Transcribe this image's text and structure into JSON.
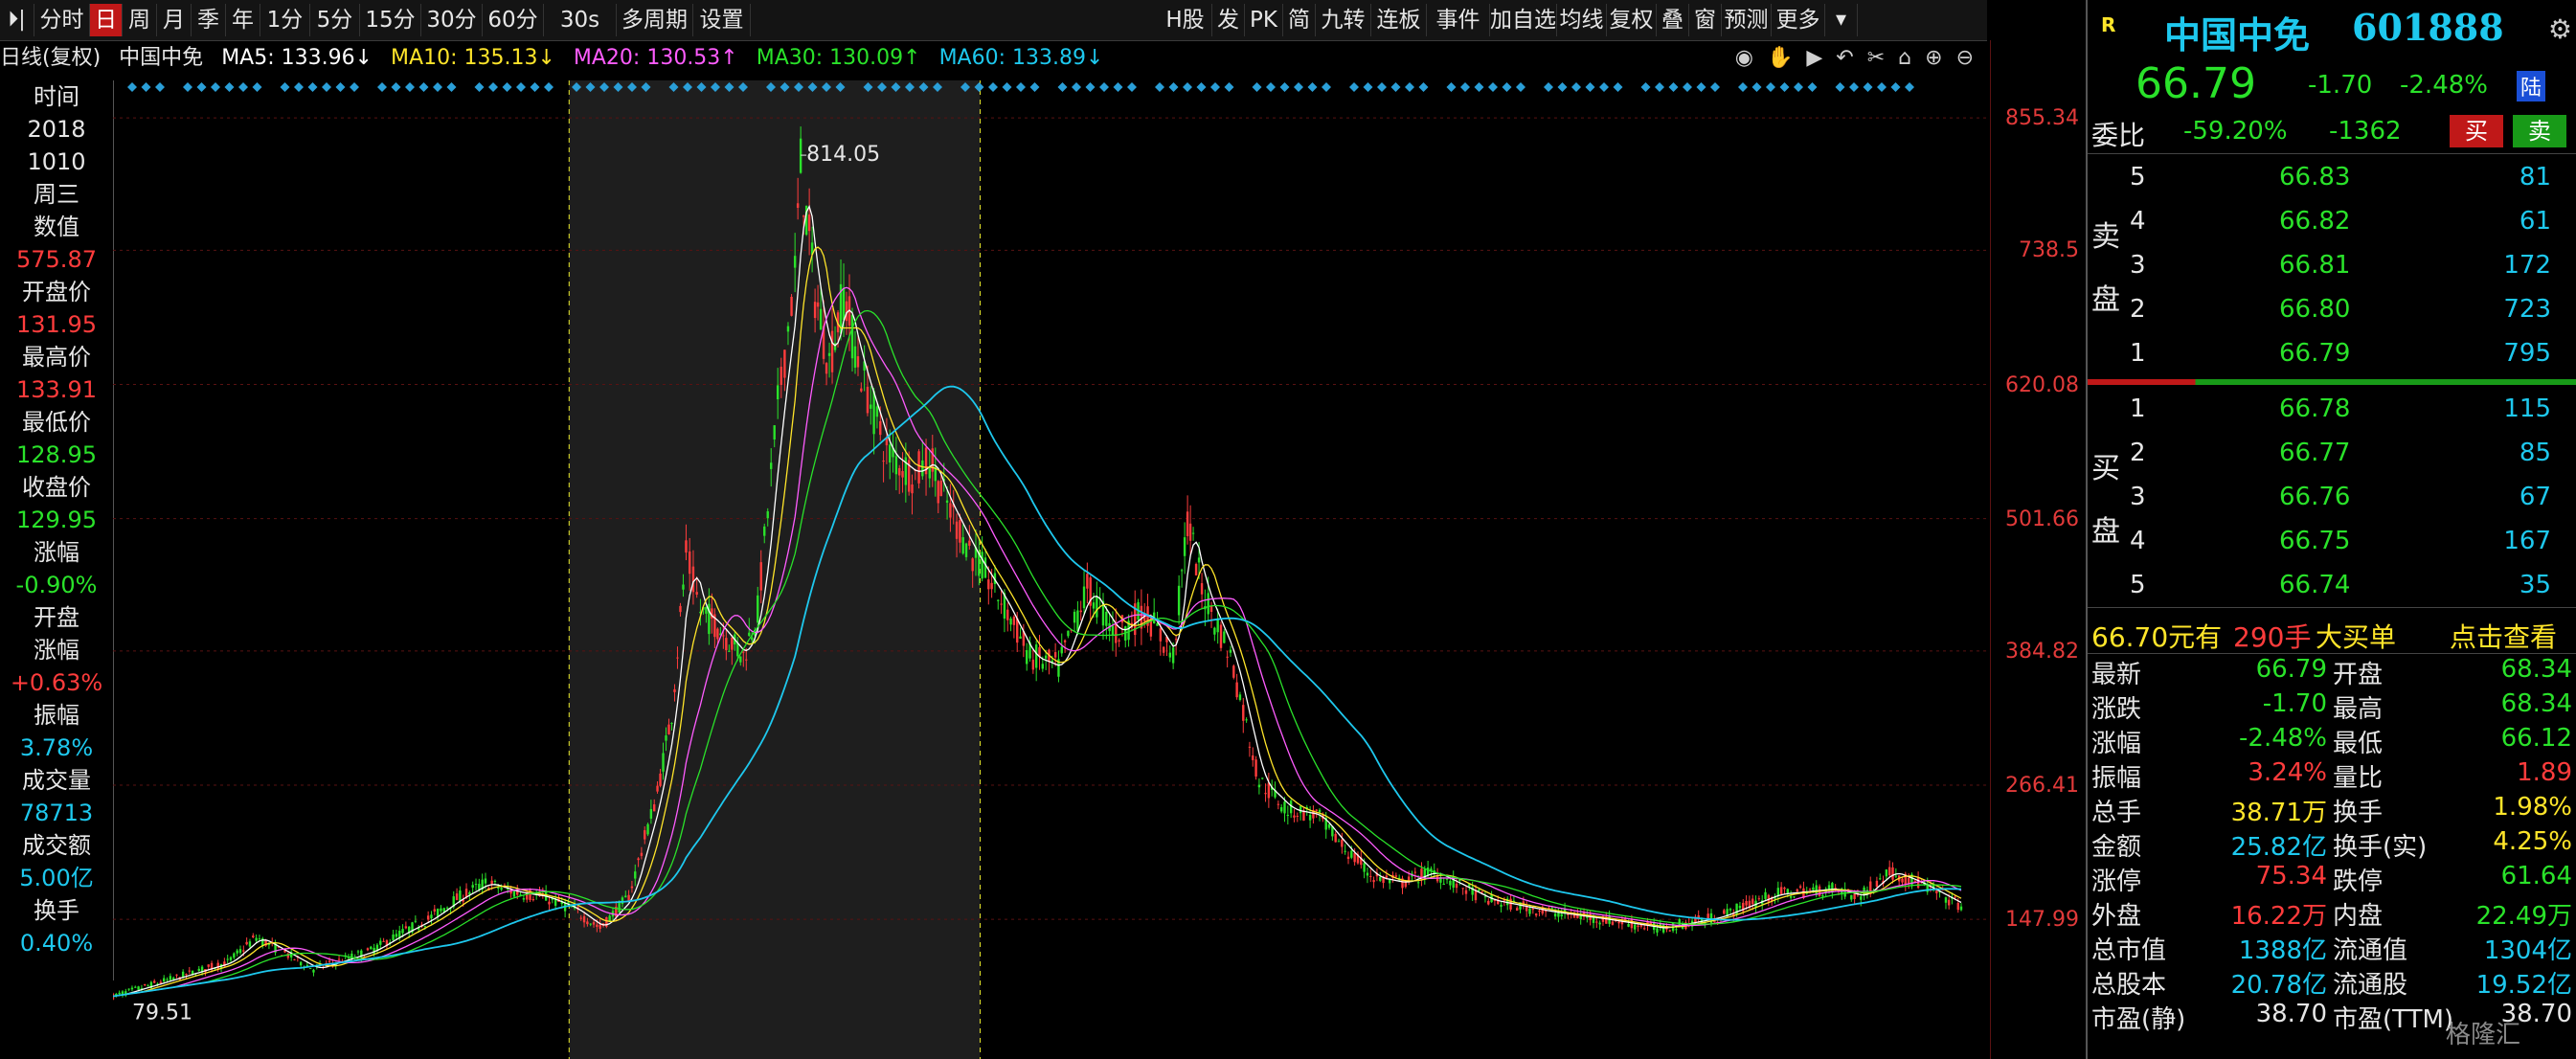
{
  "toolbar": {
    "items": [
      "分时",
      "日",
      "周",
      "月",
      "季",
      "年",
      "1分",
      "5分",
      "15分",
      "30分",
      "60分",
      "30s",
      "多周期",
      "设置"
    ],
    "active": "日",
    "right_items": [
      "H股",
      "发",
      "PK",
      "简",
      "九转",
      "连板",
      "事件",
      "加自选",
      "均线",
      "复权",
      "叠",
      "窗",
      "预测",
      "更多"
    ]
  },
  "ma": {
    "title": "日线(复权)",
    "stock": "中国中免",
    "ma5": "MA5: 133.96↓",
    "ma10": "MA10: 135.13↓",
    "ma20": "MA20: 130.53↑",
    "ma30": "MA30: 130.09↑",
    "ma60": "MA60: 133.89↓",
    "colors": {
      "ma5": "#ffffff",
      "ma10": "#ffe52a",
      "ma20": "#ff5cff",
      "ma30": "#2ae22a",
      "ma60": "#1ec8ee"
    }
  },
  "info": {
    "time_label": "时间",
    "year": "2018",
    "date": "1010",
    "weekday": "周三",
    "value_label": "数值",
    "value": "575.87",
    "open_label": "开盘价",
    "open": "131.95",
    "high_label": "最高价",
    "high": "133.91",
    "low_label": "最低价",
    "low": "128.95",
    "close_label": "收盘价",
    "close": "129.95",
    "chg_label": "涨幅",
    "chg": "-0.90%",
    "open_chg_label1": "开盘",
    "open_chg_label2": "涨幅",
    "open_chg": "+0.63%",
    "amp_label": "振幅",
    "amp": "3.78%",
    "vol_label": "成交量",
    "vol": "78713",
    "amt_label": "成交额",
    "amt": "5.00亿",
    "turn_label": "换手",
    "turn": "0.40%"
  },
  "chart_data": {
    "type": "line",
    "title": "中国中免 日线(复权)",
    "y_ticks": [
      855.34,
      738.5,
      620.08,
      501.66,
      384.82,
      266.41,
      147.99
    ],
    "ylim": [
      50,
      880
    ],
    "max_label": "814.05",
    "min_label": "79.51",
    "highlight_range": [
      0.243,
      0.462
    ],
    "series": [
      {
        "name": "MA5",
        "color": "#ffffff"
      },
      {
        "name": "MA10",
        "color": "#ffe52a"
      },
      {
        "name": "MA20",
        "color": "#ff5cff"
      },
      {
        "name": "MA30",
        "color": "#2ae22a"
      },
      {
        "name": "MA60",
        "color": "#1ec8ee"
      }
    ],
    "price_path": [
      [
        0,
        80
      ],
      [
        0.02,
        95
      ],
      [
        0.04,
        110
      ],
      [
        0.05,
        132
      ],
      [
        0.06,
        118
      ],
      [
        0.07,
        104
      ],
      [
        0.08,
        112
      ],
      [
        0.09,
        120
      ],
      [
        0.1,
        135
      ],
      [
        0.11,
        148
      ],
      [
        0.12,
        166
      ],
      [
        0.13,
        180
      ],
      [
        0.14,
        172
      ],
      [
        0.15,
        168
      ],
      [
        0.16,
        158
      ],
      [
        0.17,
        140
      ],
      [
        0.18,
        168
      ],
      [
        0.19,
        260
      ],
      [
        0.195,
        330
      ],
      [
        0.2,
        470
      ],
      [
        0.205,
        420
      ],
      [
        0.21,
        410
      ],
      [
        0.215,
        395
      ],
      [
        0.22,
        380
      ],
      [
        0.225,
        420
      ],
      [
        0.232,
        600
      ],
      [
        0.238,
        720
      ],
      [
        0.24,
        814
      ],
      [
        0.245,
        700
      ],
      [
        0.25,
        640
      ],
      [
        0.255,
        700
      ],
      [
        0.26,
        640
      ],
      [
        0.27,
        560
      ],
      [
        0.28,
        540
      ],
      [
        0.285,
        555
      ],
      [
        0.29,
        520
      ],
      [
        0.3,
        470
      ],
      [
        0.31,
        430
      ],
      [
        0.32,
        380
      ],
      [
        0.33,
        370
      ],
      [
        0.34,
        440
      ],
      [
        0.35,
        400
      ],
      [
        0.36,
        420
      ],
      [
        0.37,
        380
      ],
      [
        0.375,
        500
      ],
      [
        0.38,
        440
      ],
      [
        0.39,
        380
      ],
      [
        0.4,
        270
      ],
      [
        0.41,
        245
      ],
      [
        0.42,
        240
      ],
      [
        0.43,
        210
      ],
      [
        0.44,
        185
      ],
      [
        0.45,
        180
      ],
      [
        0.46,
        190
      ],
      [
        0.48,
        165
      ],
      [
        0.5,
        155
      ],
      [
        0.52,
        148
      ],
      [
        0.54,
        140
      ],
      [
        0.56,
        150
      ],
      [
        0.58,
        170
      ],
      [
        0.6,
        175
      ],
      [
        0.61,
        168
      ],
      [
        0.62,
        190
      ],
      [
        0.63,
        180
      ],
      [
        0.645,
        160
      ]
    ]
  },
  "quote": {
    "logo": "R",
    "name": "中国中免",
    "code": "601888",
    "price": "66.79",
    "change": "-1.70",
    "pct": "-2.48%",
    "tag": "陆",
    "weibi_label": "委比",
    "weibi": "-59.20%",
    "weicha": "-1362",
    "buy_btn": "买",
    "sell_btn": "卖",
    "sell_label": [
      "卖",
      "盘"
    ],
    "buy_label": [
      "买",
      "盘"
    ],
    "asks": [
      {
        "lvl": "5",
        "price": "66.83",
        "vol": "81"
      },
      {
        "lvl": "4",
        "price": "66.82",
        "vol": "61"
      },
      {
        "lvl": "3",
        "price": "66.81",
        "vol": "172"
      },
      {
        "lvl": "2",
        "price": "66.80",
        "vol": "723"
      },
      {
        "lvl": "1",
        "price": "66.79",
        "vol": "795"
      }
    ],
    "bids": [
      {
        "lvl": "1",
        "price": "66.78",
        "vol": "115"
      },
      {
        "lvl": "2",
        "price": "66.77",
        "vol": "85"
      },
      {
        "lvl": "3",
        "price": "66.76",
        "vol": "67"
      },
      {
        "lvl": "4",
        "price": "66.75",
        "vol": "167"
      },
      {
        "lvl": "5",
        "price": "66.74",
        "vol": "35"
      }
    ],
    "big_order": {
      "price": "66.70元有",
      "qty": "290手",
      "text": "大买单",
      "link": "点击查看"
    },
    "stats": [
      {
        "k1": "最新",
        "v1": "66.79",
        "c1": "#2ae22a",
        "k2": "开盘",
        "v2": "68.34",
        "c2": "#2ae22a"
      },
      {
        "k1": "涨跌",
        "v1": "-1.70",
        "c1": "#2ae22a",
        "k2": "最高",
        "v2": "68.34",
        "c2": "#2ae22a"
      },
      {
        "k1": "涨幅",
        "v1": "-2.48%",
        "c1": "#2ae22a",
        "k2": "最低",
        "v2": "66.12",
        "c2": "#2ae22a"
      },
      {
        "k1": "振幅",
        "v1": "3.24%",
        "c1": "#ff3c3c",
        "k2": "量比",
        "v2": "1.89",
        "c2": "#ff3c3c"
      },
      {
        "k1": "总手",
        "v1": "38.71万",
        "c1": "#ffe52a",
        "k2": "换手",
        "v2": "1.98%",
        "c2": "#ffe52a"
      },
      {
        "k1": "金额",
        "v1": "25.82亿",
        "c1": "#1ec8ee",
        "k2": "换手(实)",
        "v2": "4.25%",
        "c2": "#ffe52a"
      },
      {
        "k1": "涨停",
        "v1": "75.34",
        "c1": "#ff3c3c",
        "k2": "跌停",
        "v2": "61.64",
        "c2": "#2ae22a"
      },
      {
        "k1": "外盘",
        "v1": "16.22万",
        "c1": "#ff3c3c",
        "k2": "内盘",
        "v2": "22.49万",
        "c2": "#2ae22a"
      },
      {
        "k1": "总市值",
        "v1": "1388亿",
        "c1": "#1ec8ee",
        "k2": "流通值",
        "v2": "1304亿",
        "c2": "#1ec8ee"
      },
      {
        "k1": "总股本",
        "v1": "20.78亿",
        "c1": "#1ec8ee",
        "k2": "流通股",
        "v2": "19.52亿",
        "c2": "#1ec8ee"
      },
      {
        "k1": "市盈(静)",
        "v1": "38.70",
        "c1": "#e6e6e6",
        "k2": "市盈(TTM)",
        "v2": "38.70",
        "c2": "#e6e6e6"
      }
    ],
    "watermark": "格隆汇"
  }
}
